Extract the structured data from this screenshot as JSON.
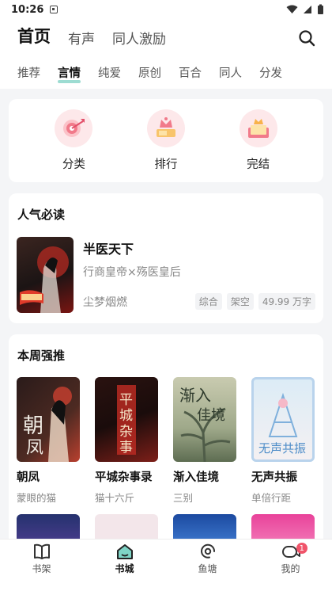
{
  "status": {
    "time": "10:26"
  },
  "top_tabs": [
    {
      "label": "首页",
      "active": true
    },
    {
      "label": "有声",
      "active": false
    },
    {
      "label": "同人激励",
      "active": false
    }
  ],
  "sub_tabs": [
    {
      "label": "推荐"
    },
    {
      "label": "言情"
    },
    {
      "label": "纯爱"
    },
    {
      "label": "原创"
    },
    {
      "label": "百合"
    },
    {
      "label": "同人"
    },
    {
      "label": "分发"
    }
  ],
  "quick": [
    {
      "label": "分类",
      "icon": "target-icon"
    },
    {
      "label": "排行",
      "icon": "crown-icon"
    },
    {
      "label": "完结",
      "icon": "book-crown-icon"
    }
  ],
  "hot": {
    "title": "人气必读",
    "book": {
      "name": "半医天下",
      "desc": "行商皇帝×殇医皇后",
      "author": "尘梦烟燃",
      "tags": [
        "综合",
        "架空",
        "49.99 万字"
      ]
    }
  },
  "weekly": {
    "title": "本周强推",
    "books": [
      {
        "name": "朝凤",
        "author": "蒙眼的猫",
        "colors": [
          "#2a1b1a",
          "#b9402f"
        ]
      },
      {
        "name": "平城杂事录",
        "author": "猫十六斤",
        "colors": [
          "#2a1210",
          "#7d1f19"
        ]
      },
      {
        "name": "渐入佳境",
        "author": "三别",
        "colors": [
          "#9fa98a",
          "#5e6d52"
        ]
      },
      {
        "name": "无声共振",
        "author": "单倍行距",
        "colors": [
          "#cfe6f4",
          "#f2eef2"
        ]
      }
    ],
    "more_colors": [
      "#25326e",
      "#f3e6ea",
      "#1c4aa0",
      "#e9429a"
    ]
  },
  "bottom_tabs": [
    {
      "label": "书架",
      "icon": "bookshelf-icon"
    },
    {
      "label": "书城",
      "icon": "bookstore-icon"
    },
    {
      "label": "鱼塘",
      "icon": "pond-icon"
    },
    {
      "label": "我的",
      "icon": "profile-icon",
      "badge": "1"
    }
  ]
}
